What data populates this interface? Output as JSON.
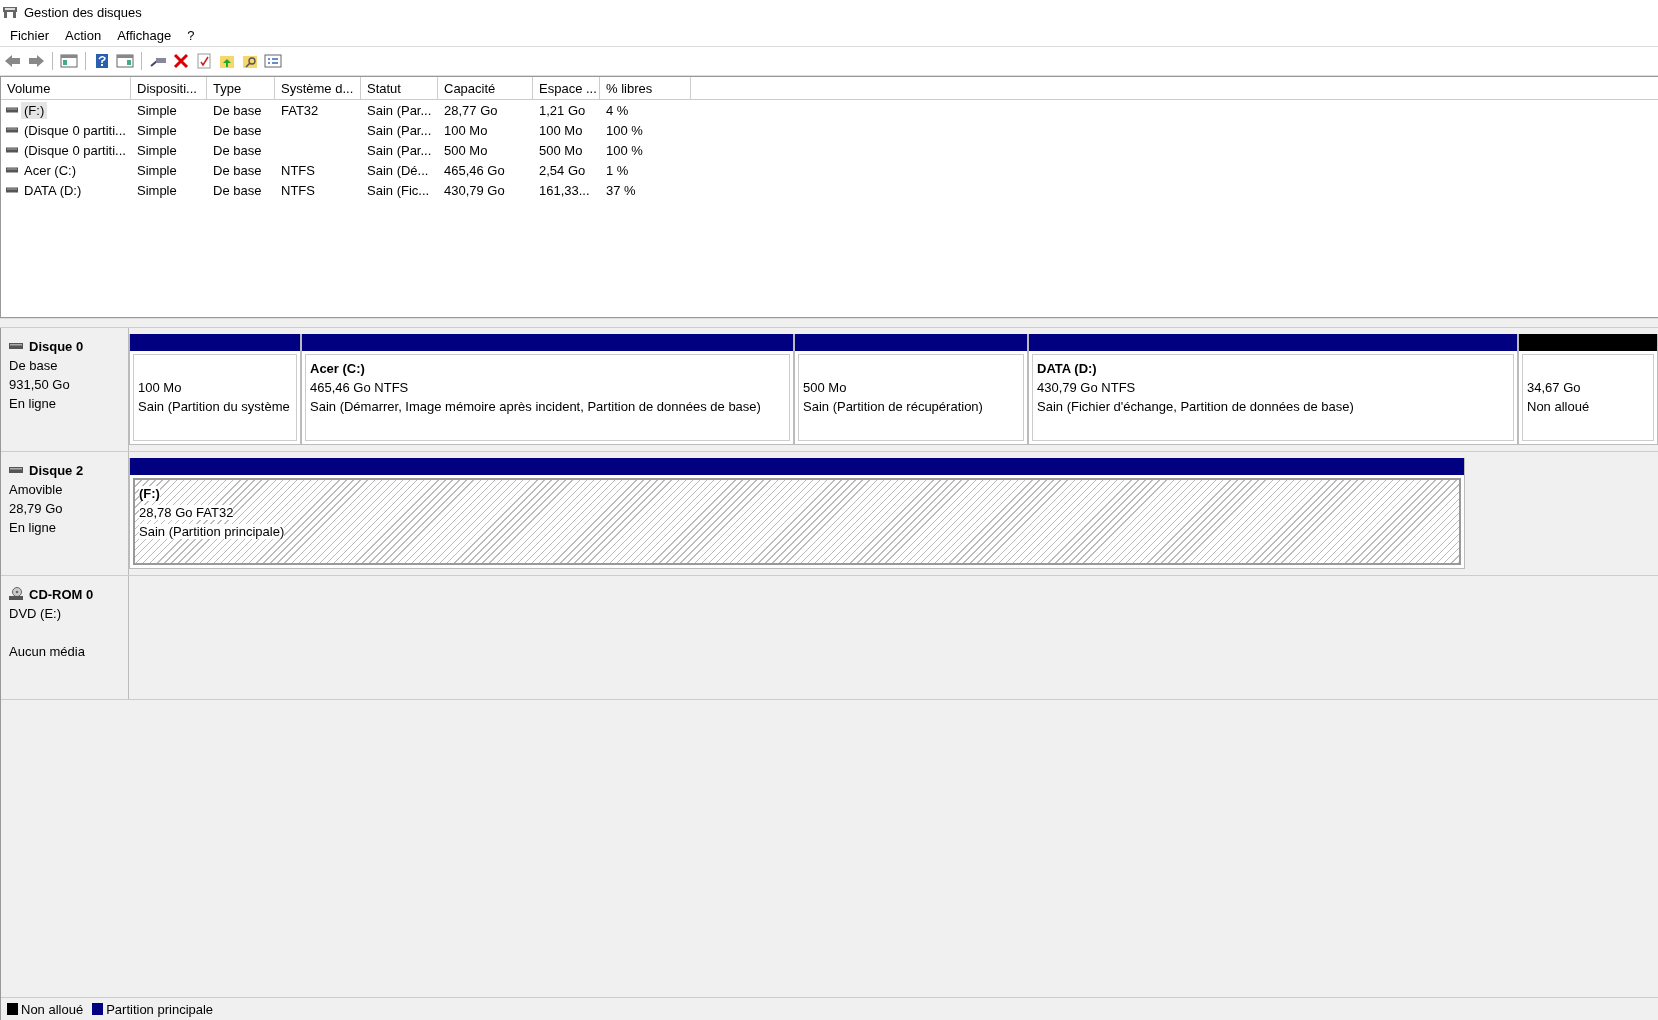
{
  "window": {
    "title": "Gestion des disques"
  },
  "menu": [
    "Fichier",
    "Action",
    "Affichage",
    "?"
  ],
  "table": {
    "columns": [
      "Volume",
      "Dispositi...",
      "Type",
      "Système d...",
      "Statut",
      "Capacité",
      "Espace ...",
      "% libres"
    ],
    "rows": [
      {
        "selected": true,
        "cells": [
          "(F:)",
          "Simple",
          "De base",
          "FAT32",
          "Sain (Par...",
          "28,77 Go",
          "1,21 Go",
          "4 %"
        ]
      },
      {
        "selected": false,
        "cells": [
          "(Disque 0 partiti...",
          "Simple",
          "De base",
          "",
          "Sain (Par...",
          "100 Mo",
          "100 Mo",
          "100 %"
        ]
      },
      {
        "selected": false,
        "cells": [
          "(Disque 0 partiti...",
          "Simple",
          "De base",
          "",
          "Sain (Par...",
          "500 Mo",
          "500 Mo",
          "100 %"
        ]
      },
      {
        "selected": false,
        "cells": [
          "Acer (C:)",
          "Simple",
          "De base",
          "NTFS",
          "Sain (Dé...",
          "465,46 Go",
          "2,54 Go",
          "1 %"
        ]
      },
      {
        "selected": false,
        "cells": [
          "DATA (D:)",
          "Simple",
          "De base",
          "NTFS",
          "Sain (Fic...",
          "430,79 Go",
          "161,33...",
          "37 %"
        ]
      }
    ]
  },
  "disks": [
    {
      "kind": "disk",
      "name": "Disque 0",
      "lines": [
        "De base",
        "931,50 Go",
        "En ligne"
      ],
      "partitions": [
        {
          "kind": "primary",
          "selected": false,
          "size": "100 Mo",
          "status": "Sain (Partition du système"
        },
        {
          "kind": "primary",
          "selected": false,
          "name": "Acer  (C:)",
          "size": "465,46 Go NTFS",
          "status": "Sain (Démarrer, Image mémoire après incident, Partition de données de base)"
        },
        {
          "kind": "primary",
          "selected": false,
          "size": "500 Mo",
          "status": "Sain (Partition de récupération)"
        },
        {
          "kind": "primary",
          "selected": false,
          "name": "DATA  (D:)",
          "size": "430,79 Go NTFS",
          "status": "Sain (Fichier d'échange, Partition de données de base)"
        },
        {
          "kind": "unallocated",
          "selected": false,
          "size": "34,67 Go",
          "status": "Non alloué"
        }
      ]
    },
    {
      "kind": "disk",
      "name": "Disque 2",
      "lines": [
        "Amovible",
        "28,79 Go",
        "En ligne"
      ],
      "partitions": [
        {
          "kind": "primary",
          "selected": true,
          "name": "(F:)",
          "size": "28,78 Go FAT32",
          "status": "Sain (Partition principale)"
        }
      ]
    },
    {
      "kind": "cdrom",
      "name": "CD-ROM 0",
      "lines": [
        "DVD (E:)"
      ],
      "media": "Aucun média"
    }
  ],
  "legend": [
    {
      "label": "Non alloué",
      "color": "#000000"
    },
    {
      "label": "Partition principale",
      "color": "#000080"
    }
  ]
}
